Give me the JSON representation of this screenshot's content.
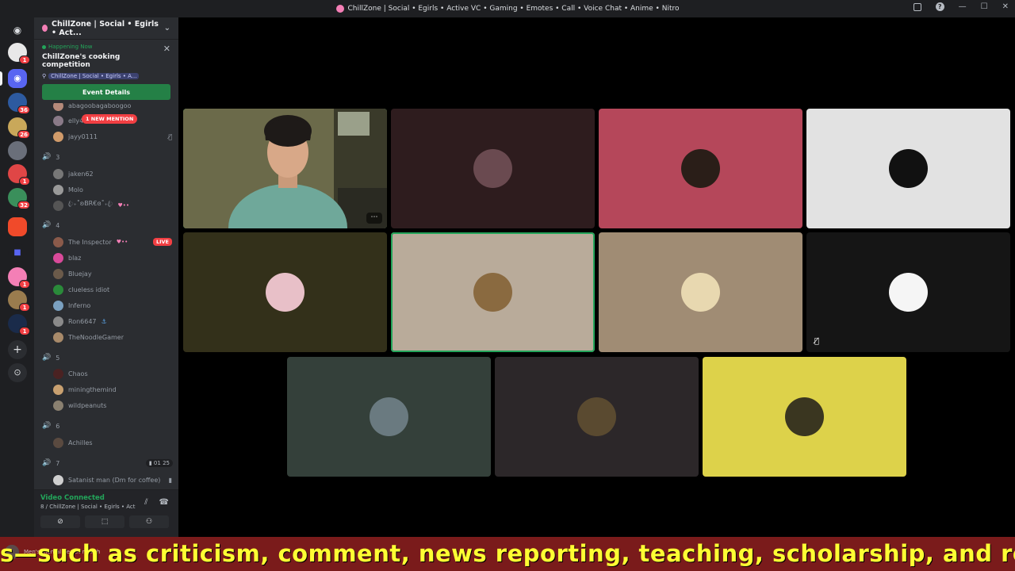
{
  "window": {
    "title": "ChillZone | Social • Egirls • Active VC • Gaming • Emotes • Call • Voice Chat • Anime • Nitro"
  },
  "server_rail": {
    "badges": [
      "1",
      "36",
      "26",
      "1",
      "32",
      "1",
      "1",
      "1"
    ]
  },
  "sidebar": {
    "server_name": "ChillZone | Social • Egirls • Act...",
    "event": {
      "status": "Happening Now",
      "title": "ChillZone's cooking competition",
      "location": "ChillZone | Social • Egirls • A...",
      "button_label": "Event Details"
    },
    "mention_pill": "1 NEW MENTION",
    "users_top": [
      "abagoobagaboogoo",
      "elly4220",
      "jayy0111"
    ],
    "channels": [
      {
        "name": "3",
        "users": [
          "jaken62",
          "Molo",
          "ꦿ₊˚ʚBR€ɞ˚₊ꦿ"
        ]
      },
      {
        "name": "4",
        "users": [
          "The Inspector",
          "blaz",
          "Bluejay",
          "clueless idiot",
          "Inferno",
          "Ron6647",
          "TheNoodleGamer"
        ]
      },
      {
        "name": "5",
        "users": [
          "Chaos",
          "miningthemind",
          "wildpeanuts"
        ]
      },
      {
        "name": "6",
        "users": [
          "Achilles"
        ]
      },
      {
        "name": "7",
        "users": [
          "Satanist man (Dm for coffee)"
        ],
        "count_a": "01",
        "count_b": "25"
      }
    ],
    "live_label": "LIVE"
  },
  "voice_panel": {
    "status": "Video Connected",
    "channel": "8 / ChillZone | Social • Egirls • Active V..."
  },
  "caption": {
    "text": "s—such as criticism, comment, news reporting, teaching, scholarship, and res",
    "background_label": "Men's mental health month"
  },
  "colors": {
    "speaking_ring": "#23a55a",
    "tile_1": "#2e1c1e",
    "tile_2": "#b5475a",
    "tile_3": "#e2e2e2",
    "tile_4": "#33301a",
    "tile_5": "#b9ab9a",
    "tile_6": "#a08c74",
    "tile_7": "#151515",
    "tile_8": "#34403a",
    "tile_9": "#2c2729",
    "tile_10": "#ddd24a"
  }
}
